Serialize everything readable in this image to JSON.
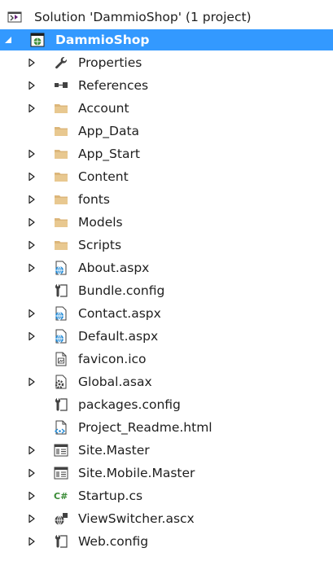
{
  "solution": {
    "label": "Solution 'DammioShop' (1 project)",
    "icon": "solution-icon"
  },
  "project": {
    "label": "DammioShop",
    "icon": "web-project-icon",
    "expanded": true,
    "selected": true,
    "selection_color": "#3399ff"
  },
  "items": [
    {
      "label": "Properties",
      "icon": "wrench-icon",
      "expandable": true
    },
    {
      "label": "References",
      "icon": "references-icon",
      "expandable": true
    },
    {
      "label": "Account",
      "icon": "folder-icon",
      "expandable": true
    },
    {
      "label": "App_Data",
      "icon": "folder-icon",
      "expandable": false
    },
    {
      "label": "App_Start",
      "icon": "folder-icon",
      "expandable": true
    },
    {
      "label": "Content",
      "icon": "folder-icon",
      "expandable": true
    },
    {
      "label": "fonts",
      "icon": "folder-icon",
      "expandable": true
    },
    {
      "label": "Models",
      "icon": "folder-icon",
      "expandable": true
    },
    {
      "label": "Scripts",
      "icon": "folder-icon",
      "expandable": true
    },
    {
      "label": "About.aspx",
      "icon": "web-form-icon",
      "expandable": true
    },
    {
      "label": "Bundle.config",
      "icon": "config-icon",
      "expandable": false
    },
    {
      "label": "Contact.aspx",
      "icon": "web-form-icon",
      "expandable": true
    },
    {
      "label": "Default.aspx",
      "icon": "web-form-icon",
      "expandable": true
    },
    {
      "label": "favicon.ico",
      "icon": "ico-file-icon",
      "expandable": false
    },
    {
      "label": "Global.asax",
      "icon": "global-asax-icon",
      "expandable": true
    },
    {
      "label": "packages.config",
      "icon": "config-icon",
      "expandable": false
    },
    {
      "label": "Project_Readme.html",
      "icon": "html-file-icon",
      "expandable": false
    },
    {
      "label": "Site.Master",
      "icon": "master-page-icon",
      "expandable": true
    },
    {
      "label": "Site.Mobile.Master",
      "icon": "master-page-icon",
      "expandable": true
    },
    {
      "label": "Startup.cs",
      "icon": "csharp-file-icon",
      "expandable": true
    },
    {
      "label": "ViewSwitcher.ascx",
      "icon": "user-control-icon",
      "expandable": true
    },
    {
      "label": "Web.config",
      "icon": "config-icon",
      "expandable": true
    }
  ],
  "colors": {
    "folder": "#dcb67a",
    "globe": "#1e88d6",
    "csharp": "#388a34",
    "icon_dark": "#424242"
  }
}
